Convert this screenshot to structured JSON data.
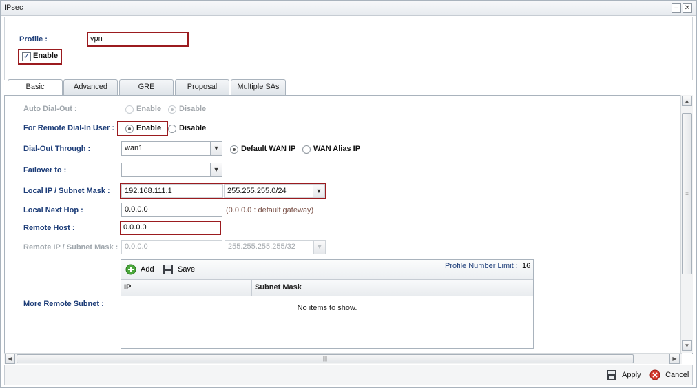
{
  "window": {
    "title": "IPsec",
    "minimize_glyph": "–",
    "close_glyph": "✕"
  },
  "profile": {
    "label": "Profile :",
    "value": "vpn",
    "enable_label": "Enable",
    "enable_checked": true
  },
  "tabs": [
    {
      "label": "Basic",
      "active": true
    },
    {
      "label": "Advanced",
      "active": false
    },
    {
      "label": "GRE",
      "active": false
    },
    {
      "label": "Proposal",
      "active": false
    },
    {
      "label": "Multiple SAs",
      "active": false
    }
  ],
  "form": {
    "auto_dial_out": {
      "label": "Auto Dial-Out :",
      "enable": "Enable",
      "disable": "Disable",
      "selected": "Disable"
    },
    "remote_dial_in": {
      "label": "For Remote Dial-In User :",
      "enable": "Enable",
      "disable": "Disable",
      "selected": "Enable"
    },
    "dial_out_through": {
      "label": "Dial-Out Through :",
      "value": "wan1",
      "opt_default": "Default WAN IP",
      "opt_alias": "WAN Alias IP",
      "selected": "Default WAN IP"
    },
    "failover": {
      "label": "Failover to :",
      "value": ""
    },
    "local_ip": {
      "label": "Local IP / Subnet Mask :",
      "ip": "192.168.111.1",
      "mask": "255.255.255.0/24"
    },
    "local_next_hop": {
      "label": "Local Next Hop :",
      "value": "0.0.0.0",
      "hint": "(0.0.0.0 : default gateway)"
    },
    "remote_host": {
      "label": "Remote Host :",
      "value": "0.0.0.0"
    },
    "remote_ip": {
      "label": "Remote IP / Subnet Mask :",
      "ip": "0.0.0.0",
      "mask": "255.255.255.255/32"
    },
    "more_remote_subnet": {
      "label": "More Remote Subnet :",
      "add_label": "Add",
      "save_label": "Save",
      "limit_label": "Profile Number Limit :",
      "limit_value": "16",
      "columns": [
        "IP",
        "Subnet Mask"
      ],
      "empty_text": "No items to show."
    }
  },
  "footer": {
    "apply_label": "Apply",
    "cancel_label": "Cancel"
  },
  "colors": {
    "label_blue": "#1d3d78",
    "highlight_red": "#9b1b1f"
  }
}
